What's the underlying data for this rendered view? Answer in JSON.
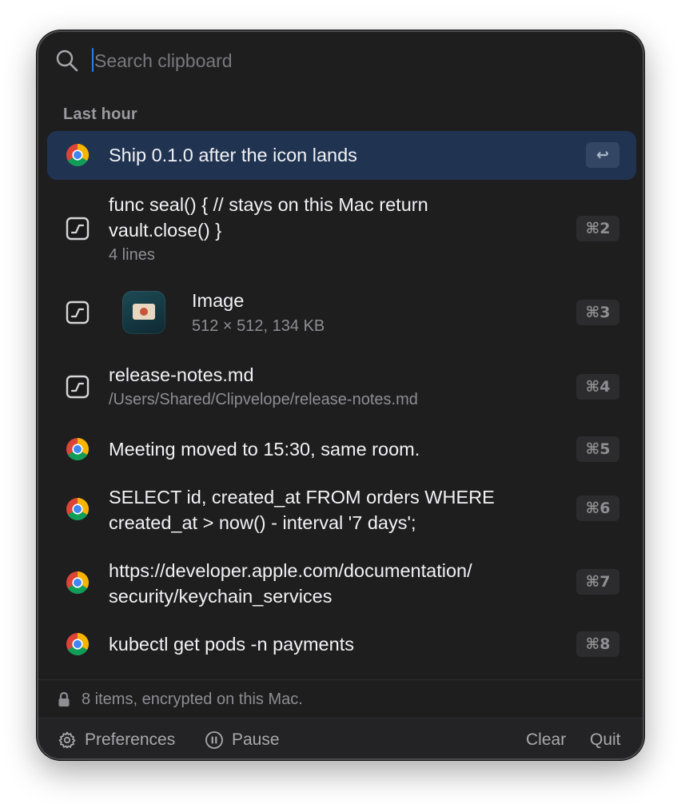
{
  "search": {
    "placeholder": "Search clipboard",
    "value": ""
  },
  "section_title": "Last hour",
  "items": [
    {
      "app": "chrome",
      "title": "Ship 0.1.0 after the icon lands",
      "shortcut": "↩",
      "selected": true
    },
    {
      "app": "terminal",
      "title_lines": [
        "func seal() { // stays on this Mac return",
        "vault.close() }"
      ],
      "subtitle": "4 lines",
      "shortcut": "⌘2"
    },
    {
      "app": "terminal",
      "type": "image",
      "title": "Image",
      "subtitle": "512 × 512, 134 KB",
      "shortcut": "⌘3"
    },
    {
      "app": "terminal",
      "title": "release-notes.md",
      "subtitle": "/Users/Shared/Clipvelope/release-notes.md",
      "shortcut": "⌘4"
    },
    {
      "app": "chrome",
      "title": "Meeting moved to 15:30, same room.",
      "shortcut": "⌘5"
    },
    {
      "app": "chrome",
      "title_lines": [
        "SELECT id, created_at FROM orders WHERE",
        "created_at > now() - interval '7 days';"
      ],
      "shortcut": "⌘6"
    },
    {
      "app": "chrome",
      "title_lines": [
        "https://developer.apple.com/documentation/",
        "security/keychain_services"
      ],
      "shortcut": "⌘7"
    },
    {
      "app": "chrome",
      "title": "kubectl get pods -n payments",
      "shortcut": "⌘8"
    }
  ],
  "status": {
    "text": "8 items, encrypted on this Mac.",
    "icon": "lock-icon"
  },
  "footer": {
    "preferences_label": "Preferences",
    "pause_label": "Pause",
    "clear_label": "Clear",
    "quit_label": "Quit"
  },
  "colors": {
    "window_bg": "#1e1e1f",
    "selected_row": "#203452",
    "accent_caret": "#2f7cf0",
    "text_primary": "#f2f2f4",
    "text_secondary": "#8e8e93"
  }
}
